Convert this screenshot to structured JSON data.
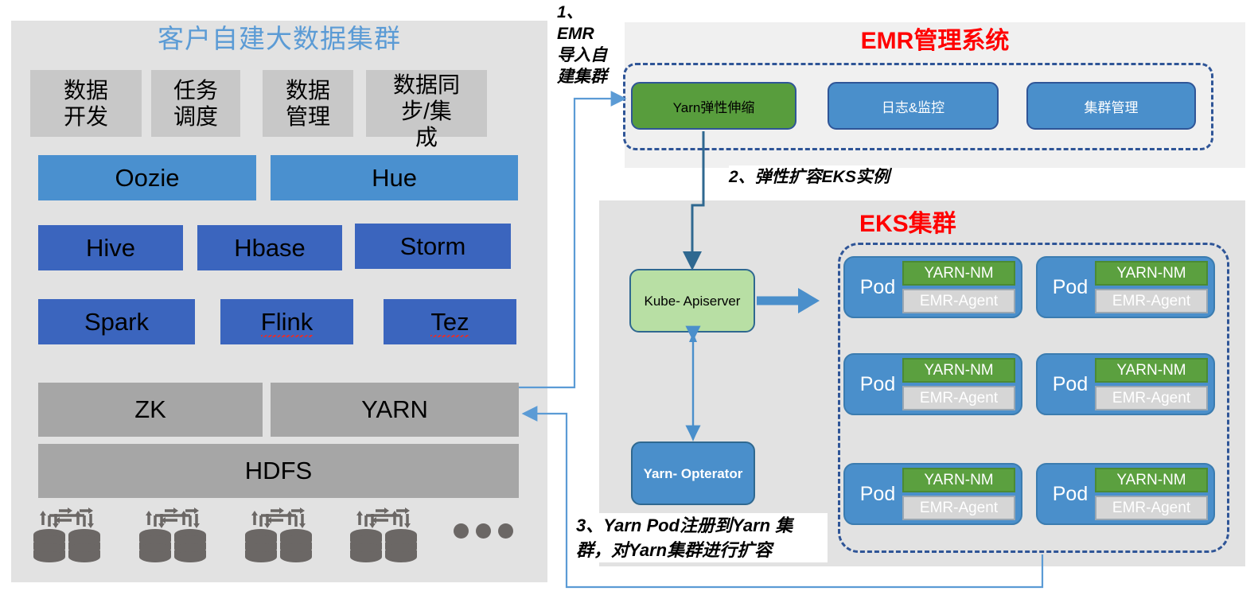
{
  "left_panel": {
    "title": "客户自建大数据集群",
    "title_color": "#5b9bd5",
    "tools": [
      {
        "label": "数据\n开发"
      },
      {
        "label": "任务\n调度"
      },
      {
        "label": "数据\n管理"
      },
      {
        "label": "数据同\n步/集\n成"
      }
    ],
    "row_oozie": [
      {
        "label": "Oozie"
      },
      {
        "label": "Hue"
      }
    ],
    "row_engines_1": [
      {
        "label": "Hive"
      },
      {
        "label": "Hbase"
      },
      {
        "label": "Storm"
      }
    ],
    "row_engines_2": [
      {
        "label": "Spark",
        "misspelled": false
      },
      {
        "label": "Flink",
        "misspelled": true
      },
      {
        "label": "Tez",
        "misspelled": true
      }
    ],
    "row_base": [
      {
        "label": "ZK"
      },
      {
        "label": "YARN"
      }
    ],
    "storage": {
      "label": "HDFS"
    },
    "disk_icon_count": 4,
    "ellipsis_dots": 3
  },
  "emr_panel": {
    "title": "EMR管理系统",
    "title_color": "#ff0000",
    "boxes": [
      {
        "label": "Yarn弹性伸缩",
        "color": "#589d3d",
        "highlight": true
      },
      {
        "label": "日志&监控",
        "color": "#4a8fcb",
        "highlight": false
      },
      {
        "label": "集群管理",
        "color": "#4a8fcb",
        "highlight": false
      }
    ]
  },
  "eks_panel": {
    "title": "EKS集群",
    "title_color": "#ff0000",
    "control": [
      {
        "label": "Kube-\nApiserver",
        "color": "#b8dfa4"
      },
      {
        "label": "Yarn-\nOpterator",
        "color": "#4a8fcb"
      }
    ],
    "pod": {
      "label": "Pod",
      "containers": [
        {
          "label": "YARN-NM",
          "color": "#5ba03f"
        },
        {
          "label": "EMR-Agent",
          "color": "#d6d6d6"
        }
      ]
    },
    "pod_count": 6,
    "pod_grid": {
      "columns": 2,
      "rows": 3
    }
  },
  "annotations": {
    "step1": "1、\nEMR\n导入自\n建集群",
    "step2": "2、弹性扩容EKS实例",
    "step3": "3、Yarn Pod注册到Yarn 集群，对Yarn集群进行扩容"
  },
  "colors": {
    "panel_bg": "#e2e2e2",
    "emr_bg": "#f0f0f0",
    "light_blue": "#4a90cf",
    "dark_blue": "#3b65be",
    "gray_band": "#a6a6a6",
    "tool_gray": "#c8c8c8",
    "dash_border": "#2f5597",
    "connector": "#5b9bd5",
    "arrow_thick": "#4a8fcb"
  }
}
